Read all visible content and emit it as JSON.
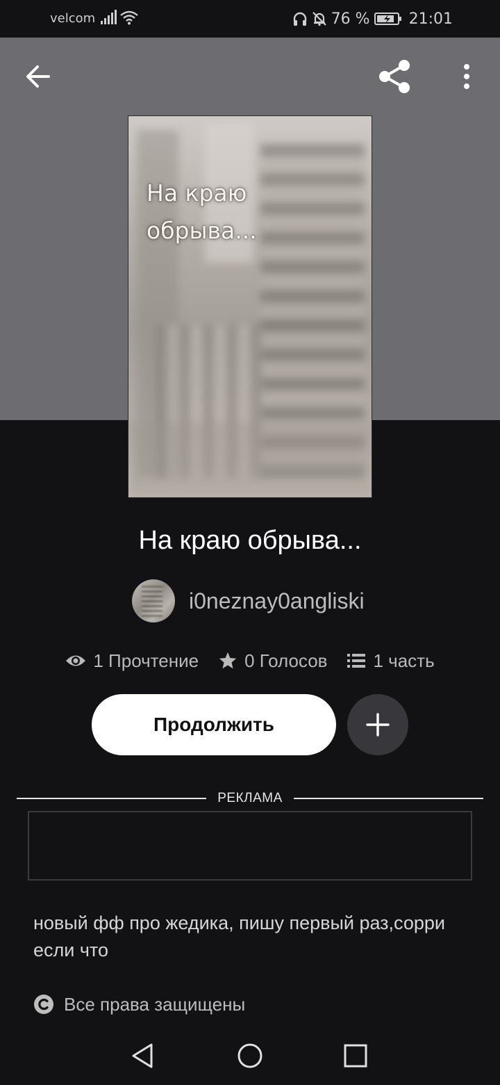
{
  "status_bar": {
    "carrier": "velcom",
    "battery": "76 %",
    "time": "21:01"
  },
  "header": {
    "back_icon": "arrow-left-icon",
    "share_icon": "share-icon",
    "more_icon": "more-vertical-icon",
    "background_color": "#6d6c70"
  },
  "cover": {
    "title": "На краю обрыва..."
  },
  "story": {
    "title": "На краю обрыва...",
    "author": "i0neznay0angliski"
  },
  "stats": {
    "reads": "1 Прочтение",
    "votes": "0 Голосов",
    "parts": "1 часть"
  },
  "actions": {
    "continue_label": "Продолжить",
    "add_icon": "plus-icon"
  },
  "ad": {
    "label": "РЕКЛАМА"
  },
  "description": "новый фф про жедика, пишу первый раз,сорри если что",
  "copyright": "Все права защищены",
  "colors": {
    "background": "#121113",
    "button_primary": "#ffffff",
    "button_secondary": "#38373b"
  }
}
